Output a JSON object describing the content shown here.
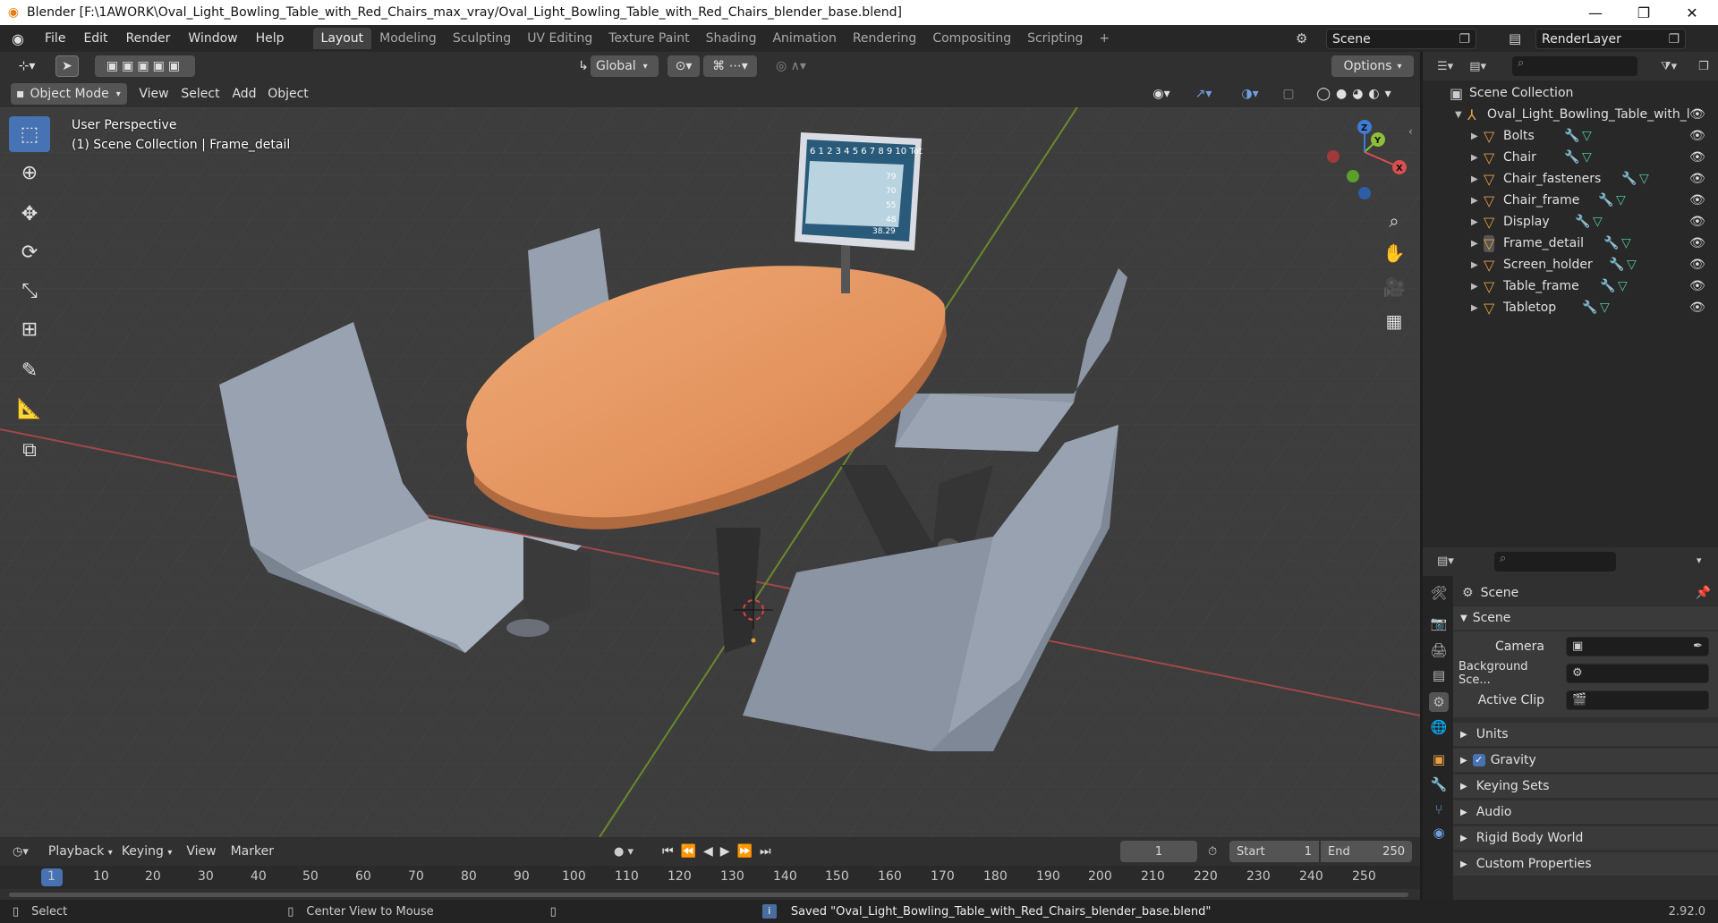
{
  "window": {
    "title": "Blender [F:\\1AWORK\\Oval_Light_Bowling_Table_with_Red_Chairs_max_vray/Oval_Light_Bowling_Table_with_Red_Chairs_blender_base.blend]",
    "minimize": "—",
    "maximize": "❐",
    "close": "✕"
  },
  "menubar": {
    "file": "File",
    "edit": "Edit",
    "render": "Render",
    "window": "Window",
    "help": "Help"
  },
  "workspaces": [
    "Layout",
    "Modeling",
    "Sculpting",
    "UV Editing",
    "Texture Paint",
    "Shading",
    "Animation",
    "Rendering",
    "Compositing",
    "Scripting"
  ],
  "add_workspace": "+",
  "scene": {
    "name": "Scene",
    "render_layer": "RenderLayer"
  },
  "viewport": {
    "transform_orientation": "Global",
    "options": "Options",
    "mode": "Object Mode",
    "menus": {
      "view": "View",
      "select": "Select",
      "add": "Add",
      "object": "Object"
    },
    "perspective": "User Perspective",
    "collection_info": "(1) Scene Collection | Frame_detail",
    "gizmo": {
      "x": "X",
      "y": "Y",
      "z": "Z"
    }
  },
  "scoreboard": {
    "header": "6 1 2 3 4 5 6 7 8 9 10 Tot",
    "scores": [
      "79",
      "70",
      "55",
      "48"
    ],
    "total": "38.29"
  },
  "outliner": {
    "scene_collection": "Scene Collection",
    "root": "Oval_Light_Bowling_Table_with_l",
    "items": [
      "Bolts",
      "Chair",
      "Chair_fasteners",
      "Chair_frame",
      "Display",
      "Frame_detail",
      "Screen_holder",
      "Table_frame",
      "Tabletop"
    ]
  },
  "properties": {
    "context": "Scene",
    "panel": "Scene",
    "camera_label": "Camera",
    "background_label": "Background Sce...",
    "active_clip_label": "Active Clip",
    "sections": [
      "Units",
      "Gravity",
      "Keying Sets",
      "Audio",
      "Rigid Body World",
      "Custom Properties"
    ],
    "gravity_checked": true
  },
  "timeline": {
    "playback": "Playback",
    "keying": "Keying",
    "view": "View",
    "marker": "Marker",
    "current_frame": "1",
    "start_label": "Start",
    "start": "1",
    "end_label": "End",
    "end": "250",
    "ticks": [
      "1",
      "10",
      "20",
      "30",
      "40",
      "50",
      "60",
      "70",
      "80",
      "90",
      "100",
      "110",
      "120",
      "130",
      "140",
      "150",
      "160",
      "170",
      "180",
      "190",
      "200",
      "210",
      "220",
      "230",
      "240",
      "250"
    ]
  },
  "statusbar": {
    "select": "Select",
    "center_view": "Center View to Mouse",
    "message": "Saved \"Oval_Light_Bowling_Table_with_Red_Chairs_blender_base.blend\"",
    "version": "2.92.0"
  },
  "colors": {
    "accent": "#4772b3",
    "tabletop": "#e3935e",
    "chair": "#9aa3b2",
    "x_axis": "#d94f4f",
    "y_axis": "#8fbf3a",
    "z_axis": "#3e7bd6"
  }
}
